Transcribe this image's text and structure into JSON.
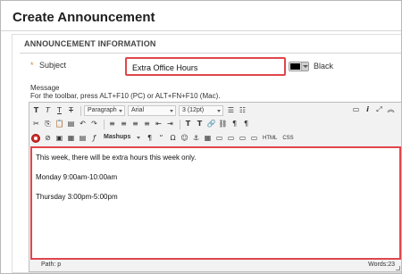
{
  "page": {
    "title": "Create Announcement"
  },
  "section": {
    "title": "ANNOUNCEMENT INFORMATION"
  },
  "subject": {
    "required_mark": "*",
    "label": "Subject",
    "value": "Extra Office Hours",
    "color_name": "Black",
    "color_value": "#000000"
  },
  "message": {
    "label": "Message",
    "toolbar_hint": "For the toolbar, press ALT+F10 (PC) or ALT+FN+F10 (Mac)."
  },
  "toolbar": {
    "row1": [
      {
        "icon": "T",
        "name": "text-style-icon-1"
      },
      {
        "icon": "T",
        "name": "text-style-icon-2"
      },
      {
        "icon": "T",
        "name": "text-style-icon-3"
      },
      {
        "icon": "T",
        "name": "text-style-icon-4"
      }
    ],
    "paragraph": "Paragraph",
    "font": "Arial",
    "size": "3 (12pt)",
    "row2": [
      {
        "icon": "✂",
        "name": "cut-icon"
      },
      {
        "icon": "⎘",
        "name": "copy-icon"
      },
      {
        "icon": "📋",
        "name": "paste-icon"
      },
      {
        "icon": "▤",
        "name": "paste-plain-icon"
      },
      {
        "icon": "↶",
        "name": "undo-icon"
      },
      {
        "icon": "↷",
        "name": "redo-icon"
      },
      {
        "icon": "≡",
        "name": "align-left-icon"
      },
      {
        "icon": "≡",
        "name": "align-center-icon"
      },
      {
        "icon": "≡",
        "name": "align-right-icon"
      },
      {
        "icon": "≡",
        "name": "align-justify-icon"
      },
      {
        "icon": "⇤",
        "name": "outdent-icon"
      },
      {
        "icon": "⇥",
        "name": "indent-icon"
      },
      {
        "icon": "T",
        "name": "superscript-icon"
      },
      {
        "icon": "T",
        "name": "subscript-icon"
      },
      {
        "icon": "🔗",
        "name": "link-icon"
      },
      {
        "icon": "⛓",
        "name": "unlink-icon"
      },
      {
        "icon": "¶",
        "name": "ltr-icon"
      },
      {
        "icon": "¶",
        "name": "rtl-icon"
      }
    ],
    "row3": [
      {
        "icon": "⊘",
        "name": "attach-icon"
      },
      {
        "icon": "▣",
        "name": "image-icon"
      },
      {
        "icon": "▦",
        "name": "media-icon"
      },
      {
        "icon": "▤",
        "name": "table-insert-icon"
      },
      {
        "icon": "ƒ",
        "name": "formula-icon"
      }
    ],
    "mashups": "Mashups",
    "row3b": [
      {
        "icon": "¶",
        "name": "paragraph-mark-icon"
      },
      {
        "icon": "“",
        "name": "quote-icon"
      },
      {
        "icon": "Ω",
        "name": "special-char-icon"
      },
      {
        "icon": "☺",
        "name": "emoticon-icon"
      },
      {
        "icon": "⚓",
        "name": "anchor-icon"
      },
      {
        "icon": "▦",
        "name": "table-icon"
      },
      {
        "icon": "▭",
        "name": "box-icon"
      },
      {
        "icon": "▭",
        "name": "cell-icon"
      },
      {
        "icon": "▭",
        "name": "row-icon"
      },
      {
        "icon": "▭",
        "name": "column-icon"
      }
    ],
    "html_label": "HTML",
    "css_label": "CSS",
    "right_icons": [
      {
        "icon": "▭",
        "name": "preview-icon"
      },
      {
        "icon": "i",
        "name": "info-icon"
      },
      {
        "icon": "⤢",
        "name": "fullscreen-icon"
      },
      {
        "icon": "︽",
        "name": "collapse-icon"
      }
    ]
  },
  "editor": {
    "lines": [
      "This week, there will be extra hours this week only.",
      "",
      "Monday 9:00am-10:00am",
      "",
      "Thursday 3:00pm-5:00pm"
    ],
    "path": "Path: p",
    "words": "Words:23"
  }
}
